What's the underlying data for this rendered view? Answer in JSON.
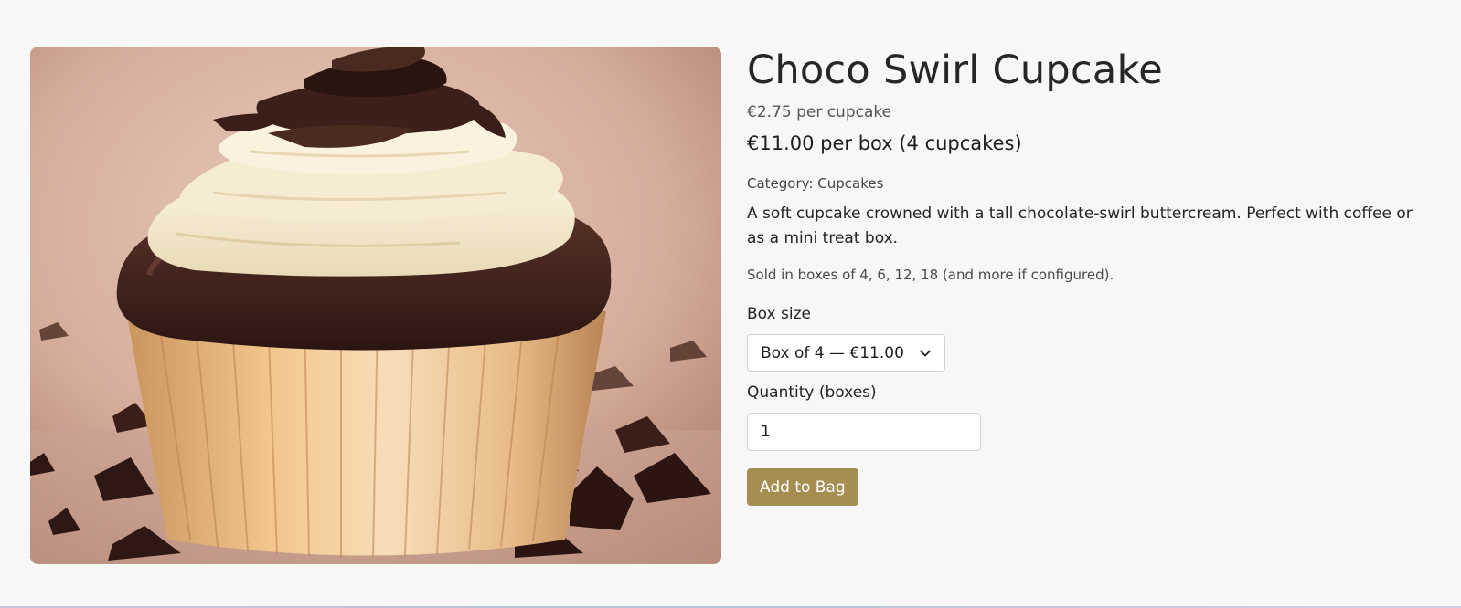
{
  "product": {
    "title": "Choco Swirl Cupcake",
    "unit_price": "€2.75 per cupcake",
    "box_price": "€11.00 per box (4 cupcakes)",
    "category": "Category: Cupcakes",
    "description": "A soft cupcake crowned with a tall chocolate-swirl buttercream. Perfect with coffee or as a mini treat box.",
    "boxes_note": "Sold in boxes of 4, 6, 12, 18 (and more if configured).",
    "image_alt": "Choco Swirl Cupcake"
  },
  "form": {
    "box_size_label": "Box size",
    "box_size_selected": "Box of 4 — €11.00",
    "quantity_label": "Quantity (boxes)",
    "quantity_value": "1",
    "add_button_label": "Add to Bag"
  },
  "icons": {
    "select_arrow": "chevron-down-icon"
  },
  "colors": {
    "accent": "#a58e4f",
    "background": "#f7f7f7"
  }
}
